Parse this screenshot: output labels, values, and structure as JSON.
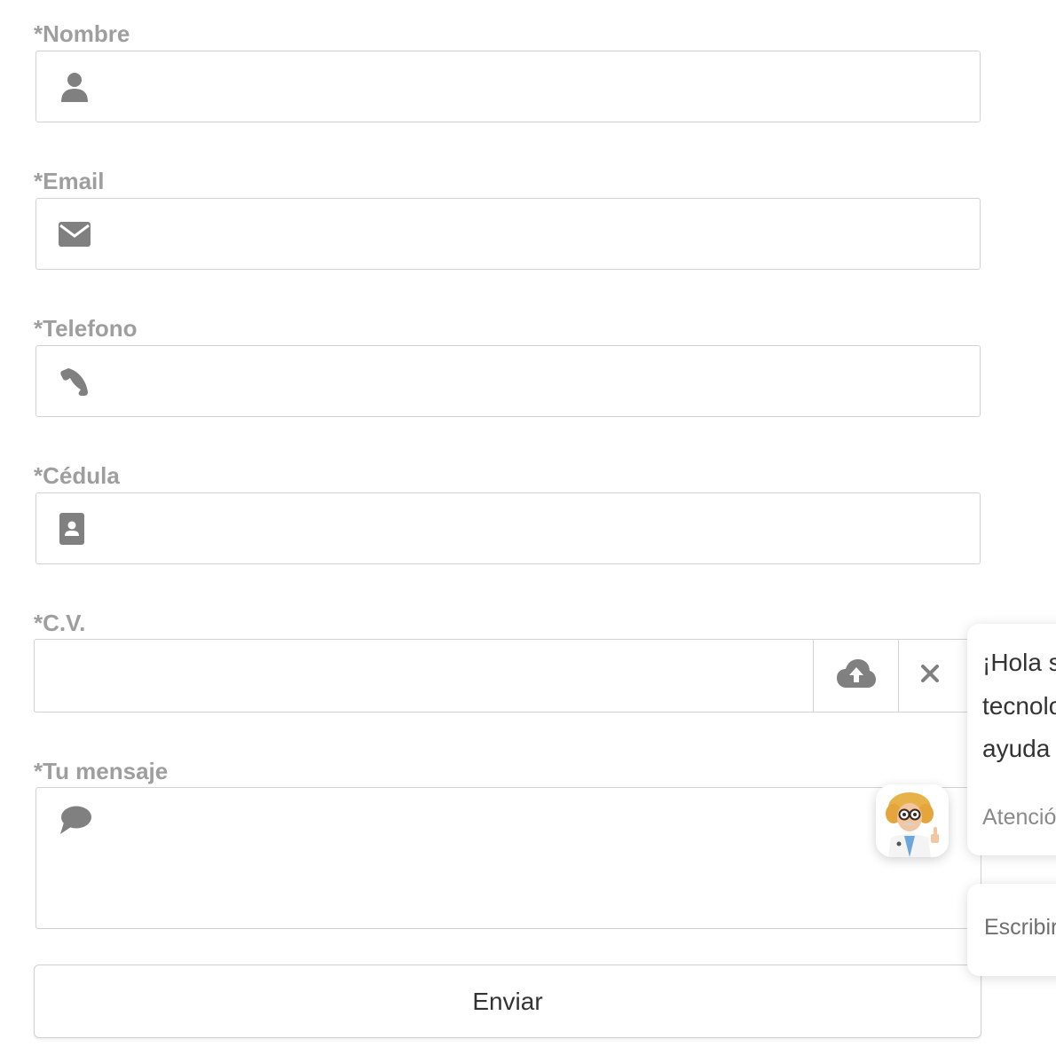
{
  "form": {
    "fields": [
      {
        "label": "*Nombre",
        "icon": "user-icon",
        "value": "",
        "placeholder": ""
      },
      {
        "label": "*Email",
        "icon": "envelope-icon",
        "value": "",
        "placeholder": ""
      },
      {
        "label": "*Telefono",
        "icon": "phone-icon",
        "value": "",
        "placeholder": ""
      },
      {
        "label": "*Cédula",
        "icon": "id-card-icon",
        "value": "",
        "placeholder": ""
      }
    ],
    "cv": {
      "label": "*C.V.",
      "upload_icon": "cloud-upload-icon",
      "clear_icon": "close-icon"
    },
    "message": {
      "label": "*Tu mensaje",
      "icon": "comment-icon",
      "value": "",
      "placeholder": ""
    },
    "submit_label": "Enviar"
  },
  "chat_widget": {
    "avatar": "assistant-avatar-icon",
    "bubble_lines": [
      "¡Hola s",
      "tecnolo",
      "ayuda"
    ],
    "bubble_subtitle": "Atenció",
    "input_placeholder": "Escribir"
  },
  "colors": {
    "label": "#9e9e9e",
    "border": "#d2d2d2",
    "icon": "#808080",
    "button_text": "#333333"
  }
}
